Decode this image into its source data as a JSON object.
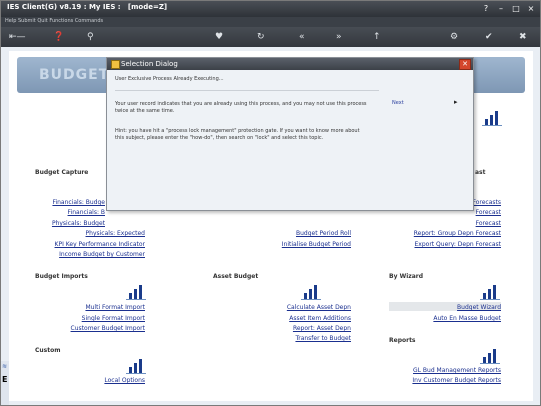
{
  "window": {
    "title": "IES Client(G) v8.19 : My IES :",
    "mode": "[mode=Z]"
  },
  "menu": {
    "items": "Help  Submit  Quit  Functions  Commands"
  },
  "banner": {
    "title": "BUDGET"
  },
  "dialog": {
    "title": "Selection Dialog",
    "message": "User Exclusive Process Already Executing...",
    "paragraph1_line1": "Your user record indicates that you are already using this process, and you may not use this process",
    "paragraph1_line2": "twice at the same time.",
    "paragraph2_line1": "Hint: you have hit a \"process lock management\" protection gate. If you want to know more about",
    "paragraph2_line2": "this subject, please enter the \"how-do\", then search on \"lock\" and select this topic.",
    "next": "Next"
  },
  "sections": {
    "capture": {
      "heading": "Budget Capture",
      "links": [
        "Financials: Budge",
        "Financials: B",
        "Physicals: Budget",
        "Physicals: Expected",
        "KPI Key Performance Indicator",
        "Income Budget by Customer"
      ]
    },
    "middle": {
      "links": [
        "Budget Period Roll",
        "Initialise Budget Period"
      ]
    },
    "right": {
      "heading_fragment": "ast",
      "links": [
        "Forecasts",
        "Forecast",
        "Forecast",
        "Report: Group Depn Forecast",
        "Export Query: Depn Forecast"
      ]
    },
    "imports": {
      "heading": "Budget Imports",
      "links": [
        "Multi Format Import",
        "Single Format Import",
        "Customer Budget Import"
      ]
    },
    "asset": {
      "heading": "Asset Budget",
      "links": [
        "Calculate Asset Depn",
        "Asset Item Additions",
        "Report: Asset Depn",
        "Transfer to Budget"
      ]
    },
    "wizard": {
      "heading": "By Wizard",
      "links": [
        "Budget Wizard",
        "Auto En Masse Budget"
      ]
    },
    "custom": {
      "heading": "Custom",
      "links": [
        "Local Options"
      ]
    },
    "reports": {
      "heading": "Reports",
      "links": [
        "GL Bud Management Reports",
        "Inv Customer Budget Reports"
      ]
    }
  },
  "left_strip": {
    "glyph": "E"
  }
}
